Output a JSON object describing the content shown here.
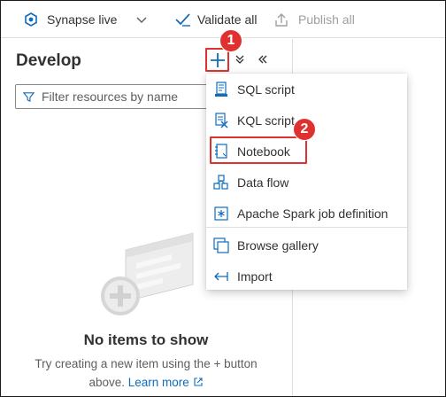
{
  "toolbar": {
    "workspace_mode": "Synapse live",
    "validate_label": "Validate all",
    "publish_label": "Publish all"
  },
  "develop": {
    "title": "Develop",
    "filter_placeholder": "Filter resources by name",
    "empty_title": "No items to show",
    "empty_line1": "Try creating a new item using the + button",
    "empty_line2": "above.",
    "learn_more": "Learn more"
  },
  "menu": {
    "items": [
      {
        "label": "SQL script",
        "icon": "sql-script-icon"
      },
      {
        "label": "KQL script",
        "icon": "kql-script-icon"
      },
      {
        "label": "Notebook",
        "icon": "notebook-icon"
      },
      {
        "label": "Data flow",
        "icon": "data-flow-icon"
      },
      {
        "label": "Apache Spark job definition",
        "icon": "spark-job-icon"
      },
      {
        "label": "Browse gallery",
        "icon": "gallery-icon"
      },
      {
        "label": "Import",
        "icon": "import-icon"
      }
    ]
  },
  "annotations": {
    "step1": "1",
    "step2": "2"
  },
  "colors": {
    "accent": "#0f6cbd",
    "highlight": "#e03131"
  }
}
